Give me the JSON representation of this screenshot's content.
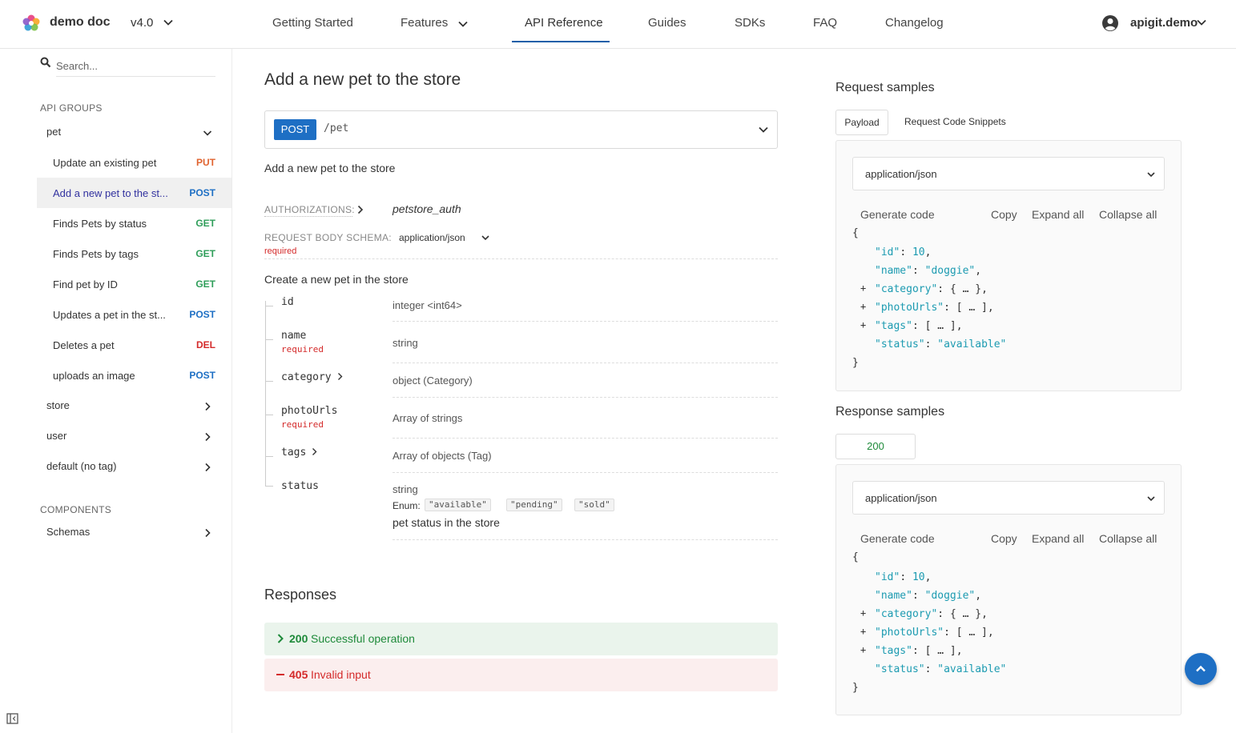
{
  "header": {
    "brand": "demo doc",
    "version": "v4.0",
    "nav": [
      "Getting Started",
      "Features",
      "API Reference",
      "Guides",
      "SDKs",
      "FAQ",
      "Changelog"
    ],
    "user": "apigit.demo"
  },
  "sidebar": {
    "search_placeholder": "Search...",
    "api_groups_title": "API GROUPS",
    "groups": [
      "pet",
      "store",
      "user",
      "default (no tag)"
    ],
    "operations": [
      {
        "label": "Update an existing pet",
        "method": "PUT"
      },
      {
        "label": "Add a new pet to the st...",
        "method": "POST"
      },
      {
        "label": "Finds Pets by status",
        "method": "GET"
      },
      {
        "label": "Finds Pets by tags",
        "method": "GET"
      },
      {
        "label": "Find pet by ID",
        "method": "GET"
      },
      {
        "label": "Updates a pet in the st...",
        "method": "POST"
      },
      {
        "label": "Deletes a pet",
        "method": "DEL"
      },
      {
        "label": "uploads an image",
        "method": "POST"
      }
    ],
    "components_title": "COMPONENTS",
    "components": [
      "Schemas"
    ]
  },
  "operation": {
    "title": "Add a new pet to the store",
    "method": "POST",
    "path": "/pet",
    "description": "Add a new pet to the store",
    "auth_label": "AUTHORIZATIONS:",
    "auth_value": "petstore_auth",
    "body_label": "REQUEST BODY SCHEMA:",
    "body_type": "application/json",
    "body_required": "required",
    "schema_description": "Create a new pet in the store",
    "properties": [
      {
        "name": "id",
        "type": "integer <int64>"
      },
      {
        "name": "name",
        "required": "required",
        "type": "string"
      },
      {
        "name": "category",
        "type": "object (Category)"
      },
      {
        "name": "photoUrls",
        "required": "required",
        "type": "Array of strings"
      },
      {
        "name": "tags",
        "type": "Array of objects (Tag)"
      },
      {
        "name": "status",
        "type": "string"
      }
    ],
    "enum_label": "Enum:",
    "enum_values": [
      "\"available\"",
      "\"pending\"",
      "\"sold\""
    ],
    "status_description": "pet status in the store",
    "responses_title": "Responses",
    "responses": [
      {
        "code": "200",
        "text": "Successful operation"
      },
      {
        "code": "405",
        "text": "Invalid input"
      }
    ]
  },
  "right_panel": {
    "request_title": "Request samples",
    "request_tabs": [
      "Payload",
      "Request Code Snippets"
    ],
    "content_type": "application/json",
    "actions": [
      "Generate code",
      "Copy",
      "Expand all",
      "Collapse all"
    ],
    "response_title": "Response samples",
    "response_tab": "200",
    "json": {
      "open": "{",
      "close": "}",
      "id_key": "\"id\"",
      "id_val": "10",
      "name_key": "\"name\"",
      "name_val": "\"doggie\"",
      "category_key": "\"category\"",
      "category_val": "{ … }",
      "photo_key": "\"photoUrls\"",
      "photo_val": "[ … ]",
      "tags_key": "\"tags\"",
      "tags_val": "[ … ]",
      "status_key": "\"status\"",
      "status_val": "\"available\""
    }
  },
  "colors": {
    "accent": "#1e6fc4",
    "put": "#e0632f",
    "get": "#2f9e5a",
    "delete": "#d42a2a",
    "json_key": "#1c9bb1"
  }
}
